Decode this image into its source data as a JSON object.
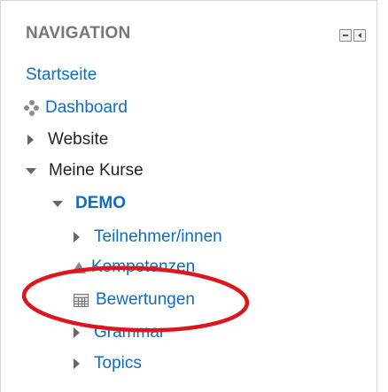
{
  "block": {
    "title": "NAVIGATION"
  },
  "nav": {
    "home": "Startseite",
    "dashboard": "Dashboard",
    "website": "Website",
    "my_courses": "Meine Kurse",
    "course": "DEMO",
    "participants": "Teilnehmer/innen",
    "competencies": "Kompetenzen",
    "grades": "Bewertungen",
    "grammar": "Grammar",
    "topics": "Topics"
  },
  "annotation": {
    "highlight_color": "#e0141c",
    "highlighted_item": "Bewertungen"
  },
  "colors": {
    "link": "#0f6cbf",
    "text": "#1d2125",
    "header": "#777777"
  }
}
